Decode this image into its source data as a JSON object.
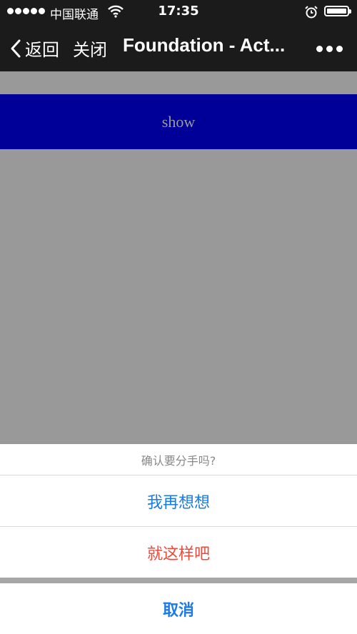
{
  "status_bar": {
    "carrier": "中国联通",
    "time": "17:35",
    "icons": [
      "signal-dots-icon",
      "wifi-icon",
      "alarm-icon",
      "battery-icon"
    ]
  },
  "nav": {
    "back_label": "返回",
    "close_label": "关闭",
    "title": "Foundation - Act...",
    "more_icon": "more-icon"
  },
  "page": {
    "show_button_label": "show"
  },
  "action_sheet": {
    "title": "确认要分手吗?",
    "options": [
      {
        "label": "我再想想",
        "color": "#1a7ae8"
      },
      {
        "label": "就这样吧",
        "color": "#e84a3c"
      }
    ],
    "cancel_label": "取消",
    "cancel_color": "#1a7ae8"
  }
}
